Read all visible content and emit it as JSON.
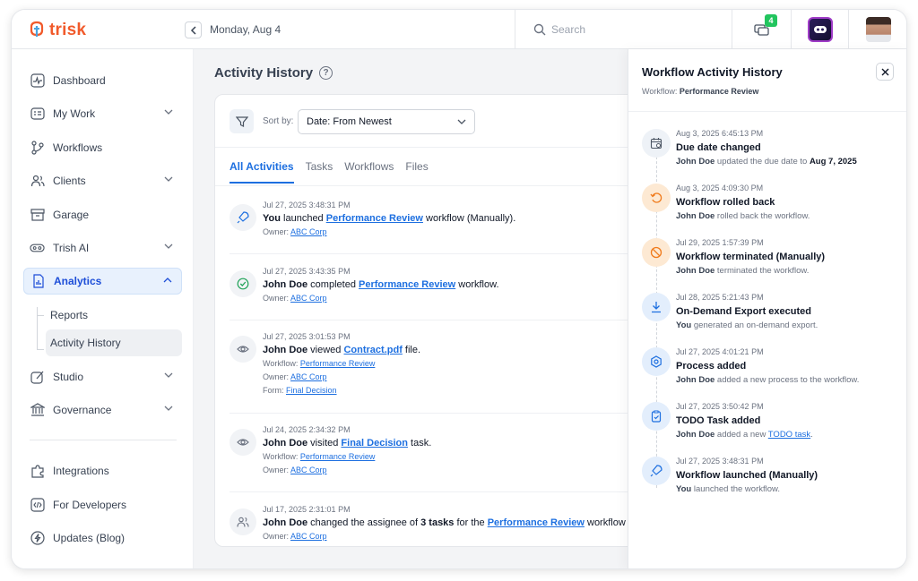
{
  "header": {
    "logo_text": "trisk",
    "date": "Monday, Aug 4",
    "search_placeholder": "Search",
    "notification_count": "4"
  },
  "sidebar": {
    "items": [
      {
        "label": "Dashboard"
      },
      {
        "label": "My Work"
      },
      {
        "label": "Workflows"
      },
      {
        "label": "Clients"
      },
      {
        "label": "Garage"
      },
      {
        "label": "Trish AI"
      },
      {
        "label": "Analytics"
      },
      {
        "label": "Studio"
      },
      {
        "label": "Governance"
      }
    ],
    "analytics_sub": [
      {
        "label": "Reports"
      },
      {
        "label": "Activity History"
      }
    ],
    "bottom_items": [
      {
        "label": "Integrations"
      },
      {
        "label": "For Developers"
      },
      {
        "label": "Updates (Blog)"
      }
    ]
  },
  "main": {
    "title": "Activity History",
    "help": "?",
    "sort_label": "Sort by:",
    "sort_value": "Date: From Newest",
    "tabs": [
      {
        "label": "All Activities"
      },
      {
        "label": "Tasks"
      },
      {
        "label": "Workflows"
      },
      {
        "label": "Files"
      }
    ],
    "activities": [
      {
        "time": "Jul 27, 2025 3:48:31 PM",
        "actor": "You",
        "verb": " launched ",
        "link": "Performance Review",
        "rest": " workflow (Manually).",
        "owner_label": "Owner: ",
        "owner": "ABC Corp"
      },
      {
        "time": "Jul 27, 2025 3:43:35 PM",
        "actor": "John Doe",
        "verb": " completed ",
        "link": "Performance Review",
        "rest": " workflow.",
        "owner_label": "Owner: ",
        "owner": "ABC Corp"
      },
      {
        "time": "Jul 27, 2025 3:01:53 PM",
        "actor": "John Doe",
        "verb": " viewed ",
        "link": "Contract.pdf",
        "rest": " file.",
        "workflow_label": "Workflow: ",
        "workflow": "Performance Review",
        "owner_label": "Owner: ",
        "owner": "ABC Corp",
        "form_label": "Form: ",
        "form": "Final Decision"
      },
      {
        "time": "Jul 24, 2025 2:34:32 PM",
        "actor": "John Doe",
        "verb": " visited ",
        "link": "Final Decision",
        "rest": " task.",
        "workflow_label": "Workflow: ",
        "workflow": "Performance Review",
        "owner_label": "Owner: ",
        "owner": "ABC Corp"
      },
      {
        "time": "Jul 17, 2025 2:31:01 PM",
        "actor": "John Doe",
        "verb": " changed the assignee of ",
        "count": "3 tasks",
        "mid": " for the ",
        "link": "Performance Review",
        "rest": " workflow fro",
        "owner_label": "Owner: ",
        "owner": "ABC Corp"
      }
    ]
  },
  "panel": {
    "title": "Workflow Activity History",
    "subtitle_label": "Workflow: ",
    "subtitle_value": "Performance Review",
    "events": [
      {
        "time": "Aug 3, 2025 6:45:13 PM",
        "title": "Due date changed",
        "actor": "John Doe",
        "desc": " updated the due date to ",
        "extra": "Aug 7, 2025",
        "icon": "calendar-icon"
      },
      {
        "time": "Aug 3, 2025 4:09:30 PM",
        "title": "Workflow rolled back",
        "actor": "John Doe",
        "desc": " rolled back the workflow.",
        "icon": "undo-icon"
      },
      {
        "time": "Jul 29, 2025 1:57:39 PM",
        "title": "Workflow terminated (Manually)",
        "actor": "John Doe",
        "desc": " terminated the workflow.",
        "icon": "ban-icon"
      },
      {
        "time": "Jul 28, 2025 5:21:43 PM",
        "title": "On-Demand Export executed",
        "actor": "You",
        "desc": " generated an on-demand export.",
        "icon": "download-icon"
      },
      {
        "time": "Jul 27, 2025 4:01:21 PM",
        "title": "Process added",
        "actor": "John Doe",
        "desc": " added a new process to the workflow.",
        "icon": "gear-icon"
      },
      {
        "time": "Jul 27, 2025 3:50:42 PM",
        "title": "TODO Task added",
        "actor": "John Doe",
        "desc": " added a new ",
        "link": "TODO task",
        "after": ".",
        "icon": "clipboard-icon"
      },
      {
        "time": "Jul 27, 2025 3:48:31 PM",
        "title": "Workflow launched (Manually)",
        "actor": "You",
        "desc": " launched the workflow.",
        "icon": "rocket-icon"
      }
    ]
  },
  "colors": {
    "brand": "#f15a2b",
    "accent": "#1d6fe0",
    "badge": "#22c55e",
    "orange_icon_bg": "#fde9d3"
  }
}
